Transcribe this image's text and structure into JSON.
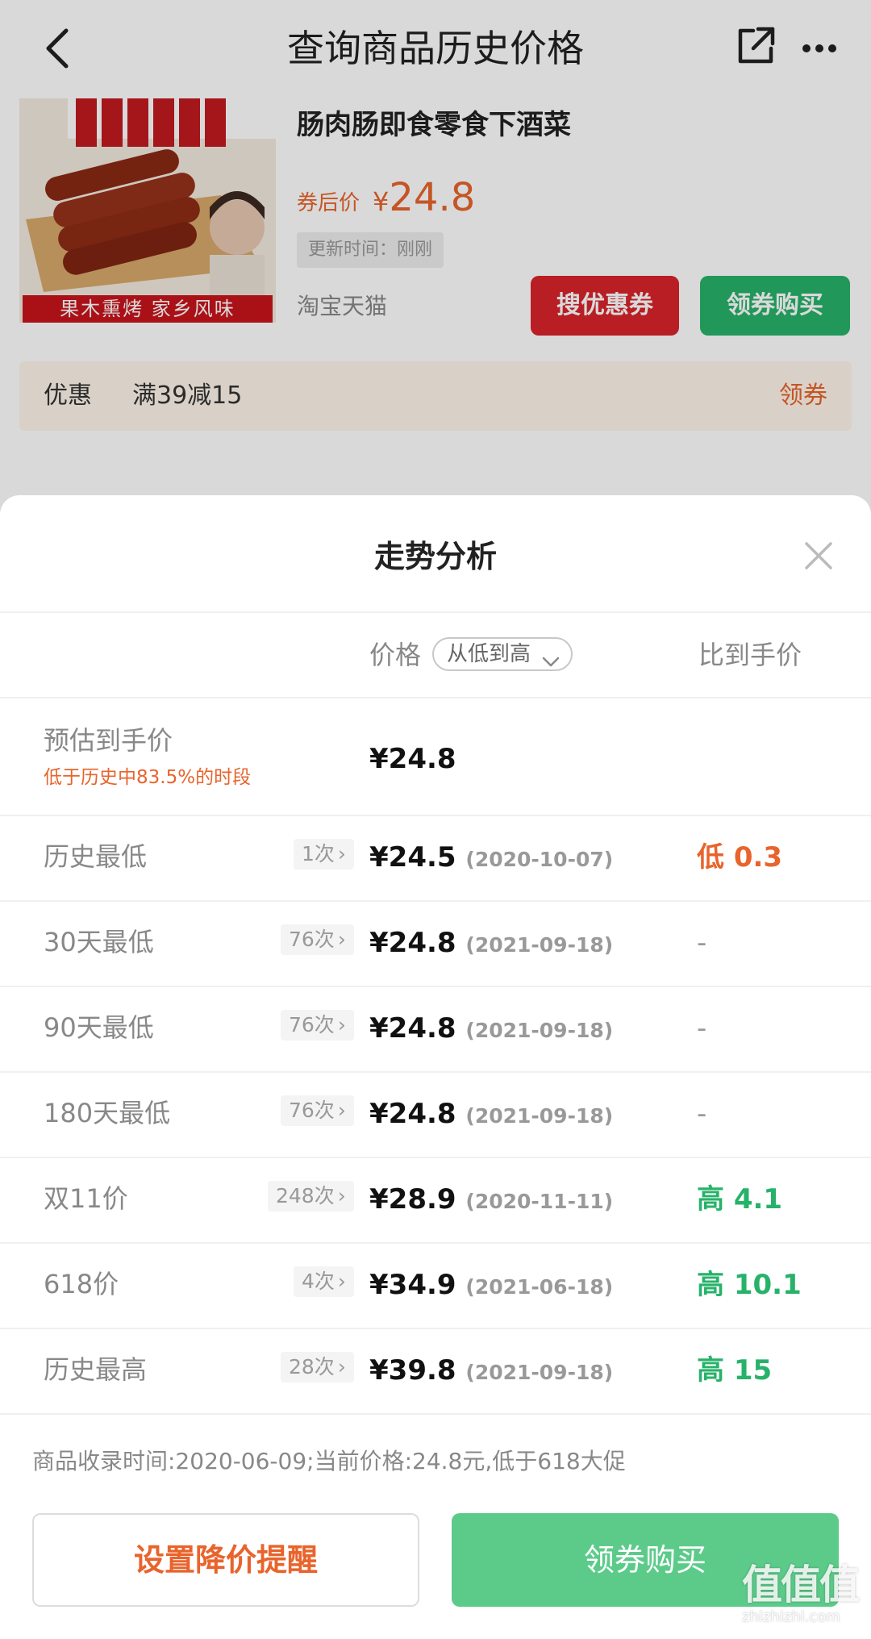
{
  "navbar": {
    "title": "查询商品历史价格",
    "icons": [
      "back-arrow-icon",
      "share-icon",
      "more-icon"
    ]
  },
  "product": {
    "name": "肠肉肠即食零食下酒菜",
    "image_banner": "果木熏烤  家乡风味",
    "price_label": "券后价",
    "currency": "¥",
    "price": "24.8",
    "update_time": "更新时间：刚刚",
    "platform": "淘宝天猫",
    "btn_search_coupon": "搜优惠券",
    "btn_buy": "领券购买"
  },
  "promo": {
    "label": "优惠",
    "value": "满39减15",
    "action": "领券"
  },
  "sheet": {
    "title": "走势分析",
    "col_price": "价格",
    "sort_label": "从低到高",
    "col_compare": "比到手价",
    "estimate": {
      "label": "预估到手价",
      "sub": "低于历史中83.5%的时段",
      "price": "¥24.8"
    },
    "rows": [
      {
        "label": "历史最低",
        "count": "1次",
        "price": "¥24.5",
        "date": "(2020-10-07)",
        "compare": "低 0.3",
        "tone": "low"
      },
      {
        "label": "30天最低",
        "count": "76次",
        "price": "¥24.8",
        "date": "(2021-09-18)",
        "compare": "-",
        "tone": "none"
      },
      {
        "label": "90天最低",
        "count": "76次",
        "price": "¥24.8",
        "date": "(2021-09-18)",
        "compare": "-",
        "tone": "none"
      },
      {
        "label": "180天最低",
        "count": "76次",
        "price": "¥24.8",
        "date": "(2021-09-18)",
        "compare": "-",
        "tone": "none"
      },
      {
        "label": "双11价",
        "count": "248次",
        "price": "¥28.9",
        "date": "(2020-11-11)",
        "compare": "高 4.1",
        "tone": "high"
      },
      {
        "label": "618价",
        "count": "4次",
        "price": "¥34.9",
        "date": "(2021-06-18)",
        "compare": "高 10.1",
        "tone": "high"
      },
      {
        "label": "历史最高",
        "count": "28次",
        "price": "¥39.8",
        "date": "(2021-09-18)",
        "compare": "高 15",
        "tone": "high"
      }
    ],
    "footer_note": "商品收录时间:2020-06-09;当前价格:24.8元,低于618大促",
    "btn_remind": "设置降价提醒",
    "btn_buy": "领券购买"
  },
  "watermark": {
    "mark": "值值值",
    "url": "zhizhizhi.com"
  },
  "colors": {
    "orange": "#e8642c",
    "green": "#27b26a",
    "red": "#d9242a"
  }
}
